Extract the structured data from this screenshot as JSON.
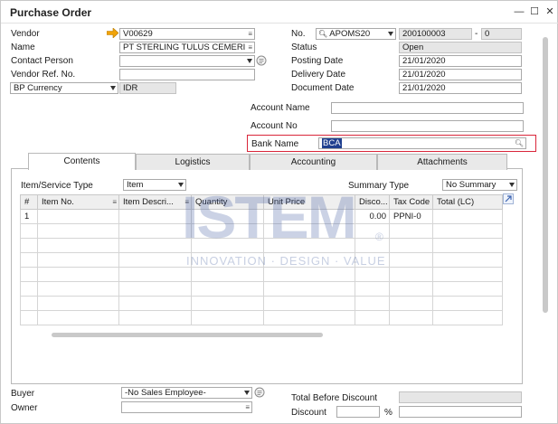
{
  "window": {
    "title": "Purchase Order",
    "minimize_glyph": "—",
    "maximize_glyph": "☐",
    "close_glyph": "✕"
  },
  "header_left": {
    "vendor_label": "Vendor",
    "vendor_value": "V00629",
    "name_label": "Name",
    "name_value": "PT STERLING TULUS CEMERI",
    "contact_label": "Contact Person",
    "contact_value": "",
    "vendor_ref_label": "Vendor Ref. No.",
    "vendor_ref_value": "",
    "currency_option": "BP Currency",
    "currency_value": "IDR"
  },
  "header_right": {
    "no_label": "No.",
    "series_value": "APOMS20",
    "doc_number": "200100003",
    "dash": "-",
    "sub_number": "0",
    "status_label": "Status",
    "status_value": "Open",
    "posting_label": "Posting Date",
    "posting_value": "21/01/2020",
    "delivery_label": "Delivery Date",
    "delivery_value": "21/01/2020",
    "document_label": "Document Date",
    "document_value": "21/01/2020"
  },
  "bank": {
    "account_name_label": "Account Name",
    "account_name_value": "",
    "account_no_label": "Account No",
    "account_no_value": "",
    "bank_name_label": "Bank Name",
    "bank_name_value": "BCA"
  },
  "tabs": [
    {
      "label": "Contents",
      "active": true
    },
    {
      "label": "Logistics",
      "active": false
    },
    {
      "label": "Accounting",
      "active": false
    },
    {
      "label": "Attachments",
      "active": false
    }
  ],
  "contents": {
    "item_type_label": "Item/Service Type",
    "item_type_value": "Item",
    "summary_type_label": "Summary Type",
    "summary_type_value": "No Summary",
    "columns": [
      "#",
      "Item No.",
      "Item Descri...",
      "Quantity",
      "Unit Price",
      "Disco...",
      "Tax Code",
      "Total (LC)"
    ],
    "rows": [
      [
        "1",
        "",
        "",
        "",
        "",
        "0.00",
        "PPNI-0",
        ""
      ]
    ]
  },
  "watermark": {
    "main": "ISTEM",
    "tagline": "INNOVATION · DESIGN · VALUE",
    "reg": "®"
  },
  "footer": {
    "buyer_label": "Buyer",
    "buyer_value": "-No Sales Employee-",
    "owner_label": "Owner",
    "owner_value": "",
    "total_before_discount_label": "Total Before Discount",
    "total_before_discount_value": "",
    "discount_label": "Discount",
    "discount_pct": "",
    "percent_sign": "%",
    "discount_value": ""
  },
  "colors": {
    "highlight_border": "#d9263a",
    "selection_bg": "#1f3f8f",
    "vendor_arrow": "#f0a30a"
  }
}
